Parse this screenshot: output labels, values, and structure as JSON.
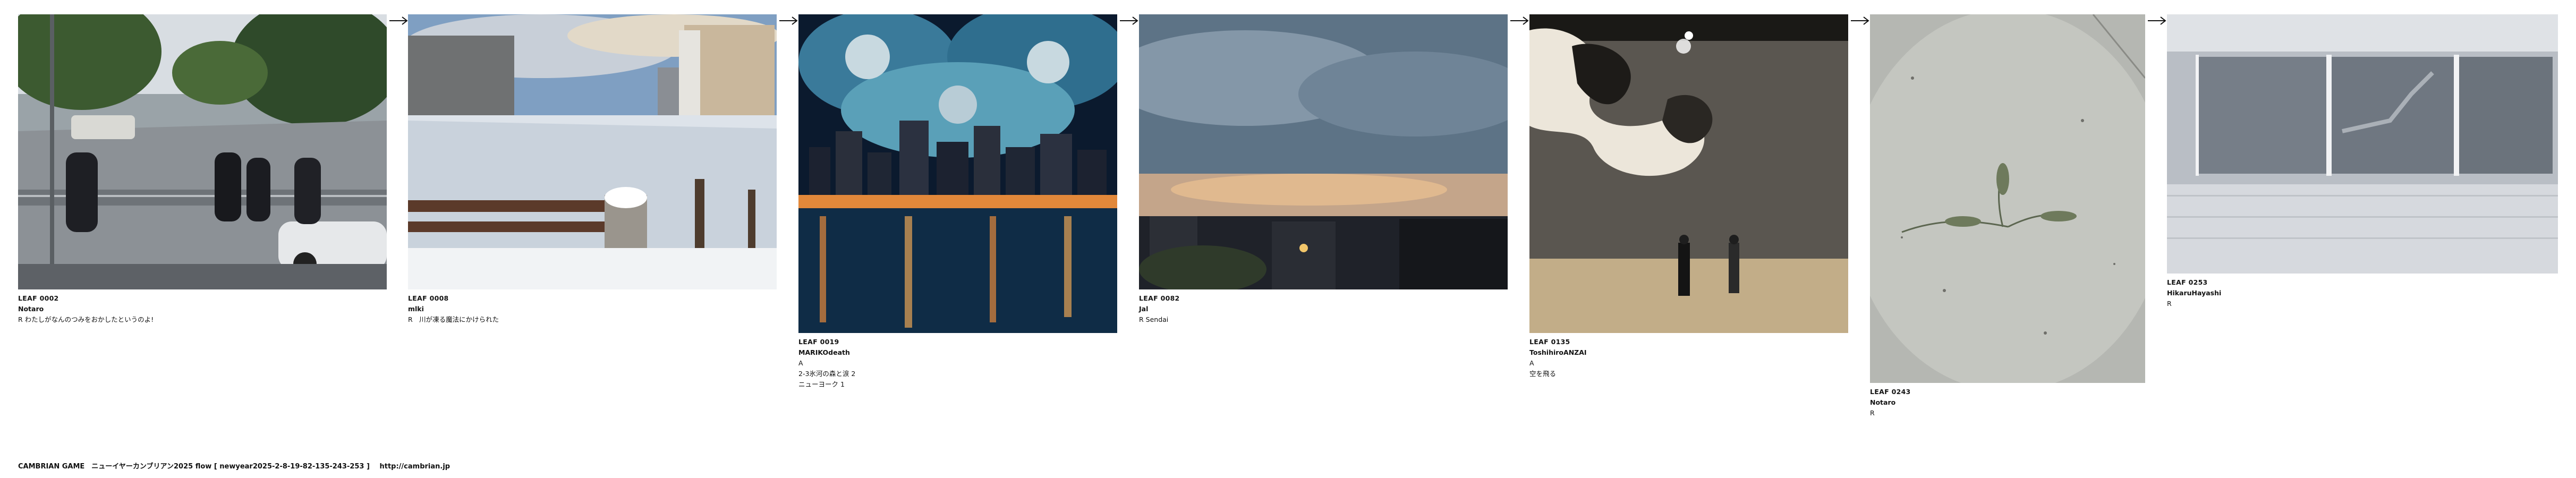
{
  "leaves": [
    {
      "id": "LEAF 0002",
      "author": "Notaro",
      "lines": [
        "R わたしがなんのつみをおかしたというのよ!"
      ]
    },
    {
      "id": "LEAF 0008",
      "author": "mlki",
      "lines": [
        "R　川が凍る魔法にかけられた"
      ]
    },
    {
      "id": "LEAF 0019",
      "author": "MARIKOdeath",
      "lines": [
        "A",
        "2-3氷河の森と涙 2",
        "ニューヨーク 1"
      ]
    },
    {
      "id": "LEAF 0082",
      "author": "Jal",
      "lines": [
        "R Sendai"
      ]
    },
    {
      "id": "LEAF 0135",
      "author": "ToshihiroANZAI",
      "lines": [
        "A",
        "空を飛る"
      ]
    },
    {
      "id": "LEAF 0243",
      "author": "Notaro",
      "lines": [
        "R"
      ]
    },
    {
      "id": "LEAF 0253",
      "author": "HikaruHayashi",
      "lines": [
        "R"
      ]
    }
  ],
  "footer": {
    "title": "CAMBRIAN GAME　ニューイヤーカンブリアン2025  flow [ newyear2025-2-8-19-82-135-243-253 ]",
    "url": "http://cambrian.jp"
  },
  "icons": [
    "arrow-right-icon"
  ]
}
